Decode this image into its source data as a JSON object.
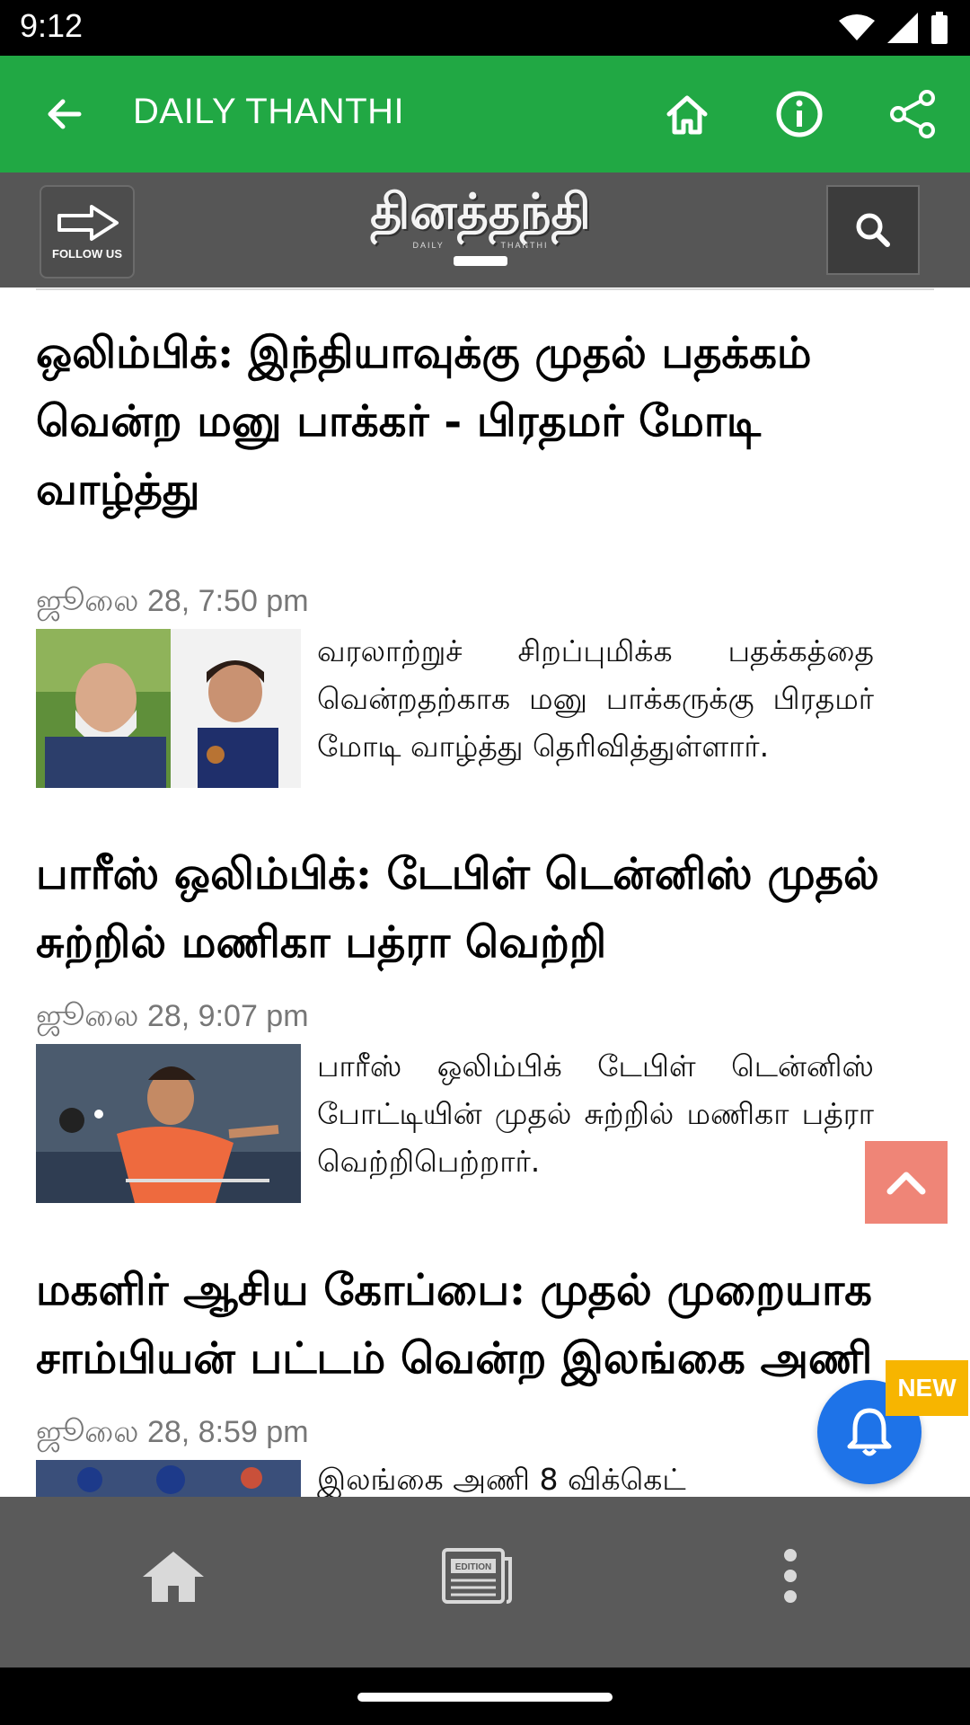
{
  "status": {
    "time": "9:12"
  },
  "app_bar": {
    "title": "DAILY THANTHI"
  },
  "logo_bar": {
    "follow_label": "FOLLOW US",
    "logo_text": "தினத்தந்தி",
    "logo_sub_left": "DAILY",
    "logo_sub_right": "THANTHI"
  },
  "articles": [
    {
      "title": "ஒலிம்பிக்: இந்தியாவுக்கு முதல் பதக்கம் வென்ற மனு பாக்கர் - பிரதமர் மோடி வாழ்த்து",
      "date": "ஜூலை 28, 7:50 pm",
      "summary": "வரலாற்றுச் சிறப்புமிக்க பதக்கத்தை வென்றதற்காக மனு பாக்கருக்கு பிரதமர் மோடி வாழ்த்து தெரிவித்துள்ளார்."
    },
    {
      "title": "பாரீஸ் ஒலிம்பிக்: டேபிள் டென்னிஸ் முதல் சுற்றில் மணிகா பத்ரா வெற்றி",
      "date": "ஜூலை 28, 9:07 pm",
      "summary": "பாரீஸ் ஒலிம்பிக் டேபிள் டென்னிஸ் போட்டியின் முதல் சுற்றில் மணிகா பத்ரா வெற்றிபெற்றார்."
    },
    {
      "title": "மகளிர் ஆசிய கோப்பை: முதல் முறையாக சாம்பியன் பட்டம் வென்ற இலங்கை அணி",
      "date": "ஜூலை 28, 8:59 pm",
      "summary": "இலங்கை அணி 8 விக்கெட்"
    }
  ],
  "badge": {
    "new_label": "NEW"
  },
  "bottom_nav": {
    "edition_label": "EDITION"
  },
  "colors": {
    "app_bar": "#21a844",
    "logo_bar": "#565656",
    "bell": "#1e73e8",
    "new_badge": "#f7b500",
    "scroll_top": "#ef8577"
  }
}
